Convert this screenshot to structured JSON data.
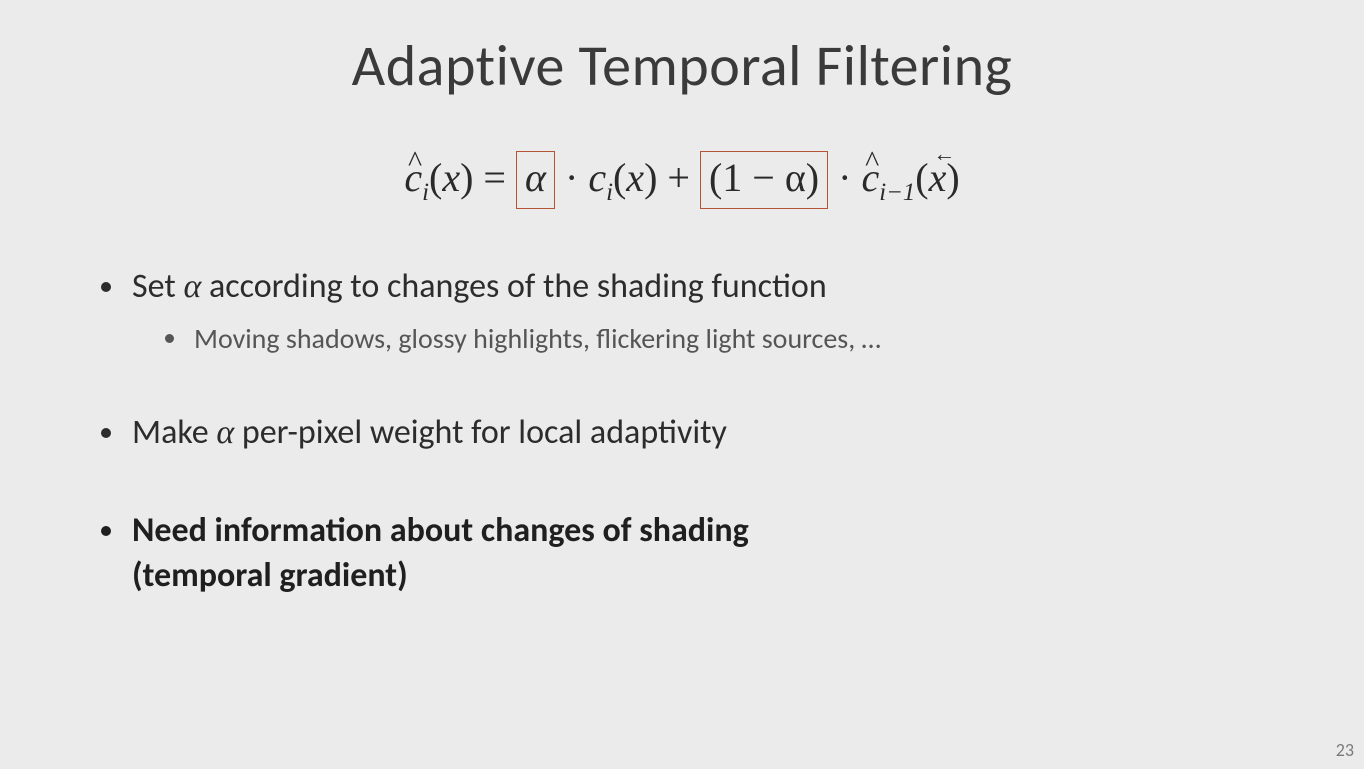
{
  "slide": {
    "title": "Adaptive Temporal Filtering",
    "equation": {
      "lhs_c": "ĉ",
      "lhs_sub": "i",
      "arg_x": "x",
      "eq": " = ",
      "alpha": "α",
      "dot": " · ",
      "c": "c",
      "plus": " + ",
      "one_minus_alpha": "(1 − α)",
      "prev_sub": "i−1"
    },
    "bullets": {
      "b1_pre": "Set ",
      "b1_alpha": "α",
      "b1_post": " according to changes of the shading function",
      "b1_sub": "Moving shadows, glossy highlights, flickering light sources, …",
      "b2_pre": "Make ",
      "b2_alpha": "α",
      "b2_post": " per-pixel weight for local adaptivity",
      "b3_line1": "Need information about changes of shading",
      "b3_line2": "(temporal gradient)"
    },
    "page_number": "23"
  }
}
